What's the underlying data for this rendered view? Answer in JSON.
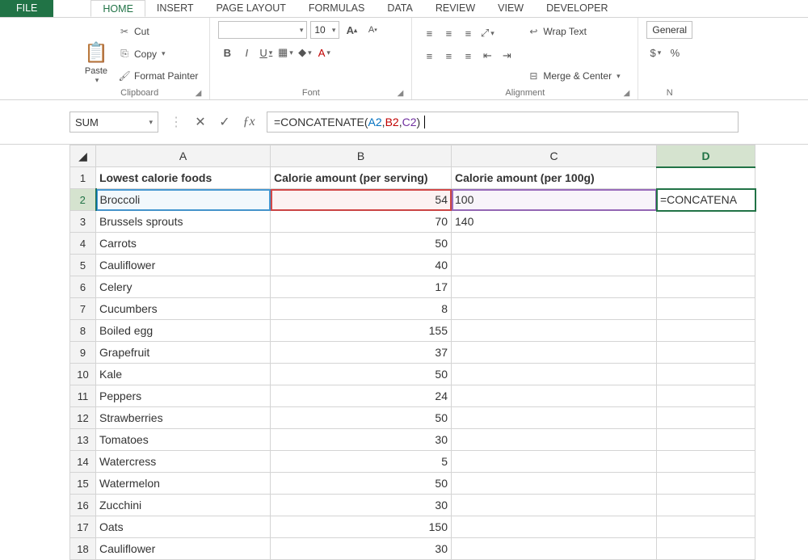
{
  "tabs": {
    "file": "FILE",
    "home": "HOME",
    "insert": "INSERT",
    "page_layout": "PAGE LAYOUT",
    "formulas": "FORMULAS",
    "data": "DATA",
    "review": "REVIEW",
    "view": "VIEW",
    "developer": "DEVELOPER"
  },
  "ribbon": {
    "clipboard": {
      "label": "Clipboard",
      "paste": "Paste",
      "cut": "Cut",
      "copy": "Copy",
      "format_painter": "Format Painter"
    },
    "font": {
      "label": "Font",
      "name": "",
      "size": "10",
      "increase": "A",
      "decrease": "A"
    },
    "alignment": {
      "label": "Alignment",
      "wrap_text": "Wrap Text",
      "merge_center": "Merge & Center"
    },
    "number": {
      "label": "N",
      "format": "General"
    }
  },
  "formula_bar": {
    "name_box": "SUM",
    "formula_prefix": "=CONCATENATE(",
    "ref_a": "A2",
    "ref_b": "B2",
    "ref_c": "C2",
    "formula_suffix": ")"
  },
  "columns": [
    "A",
    "B",
    "C",
    "D"
  ],
  "headers": {
    "a": "Lowest calorie foods",
    "b": "Calorie amount (per serving)",
    "c": "Calorie amount (per 100g)"
  },
  "active_cell_display": "=CONCATENA",
  "rows": [
    {
      "n": 2,
      "a": "Broccoli",
      "b": 54,
      "c": "100"
    },
    {
      "n": 3,
      "a": "Brussels sprouts",
      "b": 70,
      "c": "140"
    },
    {
      "n": 4,
      "a": "Carrots",
      "b": 50,
      "c": ""
    },
    {
      "n": 5,
      "a": "Cauliflower",
      "b": 40,
      "c": ""
    },
    {
      "n": 6,
      "a": "Celery",
      "b": 17,
      "c": ""
    },
    {
      "n": 7,
      "a": "Cucumbers",
      "b": 8,
      "c": ""
    },
    {
      "n": 8,
      "a": "Boiled egg",
      "b": 155,
      "c": ""
    },
    {
      "n": 9,
      "a": "Grapefruit",
      "b": 37,
      "c": ""
    },
    {
      "n": 10,
      "a": "Kale",
      "b": 50,
      "c": ""
    },
    {
      "n": 11,
      "a": "Peppers",
      "b": 24,
      "c": ""
    },
    {
      "n": 12,
      "a": "Strawberries",
      "b": 50,
      "c": ""
    },
    {
      "n": 13,
      "a": "Tomatoes",
      "b": 30,
      "c": ""
    },
    {
      "n": 14,
      "a": "Watercress",
      "b": 5,
      "c": ""
    },
    {
      "n": 15,
      "a": "Watermelon",
      "b": 50,
      "c": ""
    },
    {
      "n": 16,
      "a": "Zucchini",
      "b": 30,
      "c": ""
    },
    {
      "n": 17,
      "a": "Oats",
      "b": 150,
      "c": ""
    },
    {
      "n": 18,
      "a": "Cauliflower",
      "b": 30,
      "c": ""
    }
  ]
}
